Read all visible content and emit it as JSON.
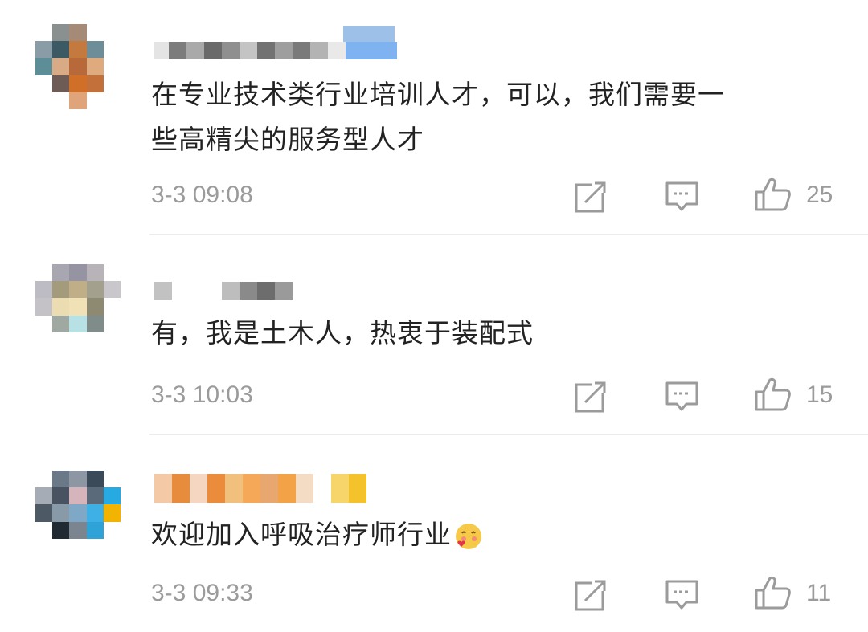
{
  "comments": [
    {
      "text_line1": "在专业技术类行业培训人才，可以，我们需要一",
      "text_line2": "些高精尖的服务型人才",
      "time": "3-3 09:08",
      "likes": "25"
    },
    {
      "text_line1": "有，我是土木人，热衷于装配式",
      "time": "3-3 10:03",
      "likes": "15"
    },
    {
      "text_line1": "欢迎加入呼吸治疗师行业",
      "emoji": "blush-emoji",
      "time": "3-3 09:33",
      "likes": "11"
    }
  ],
  "icons": {
    "share": "share-icon",
    "reply": "comment-icon",
    "like": "thumbs-up-icon"
  },
  "colors": {
    "text": "#222222",
    "meta": "#9b9b9b",
    "divider": "#ececec"
  }
}
